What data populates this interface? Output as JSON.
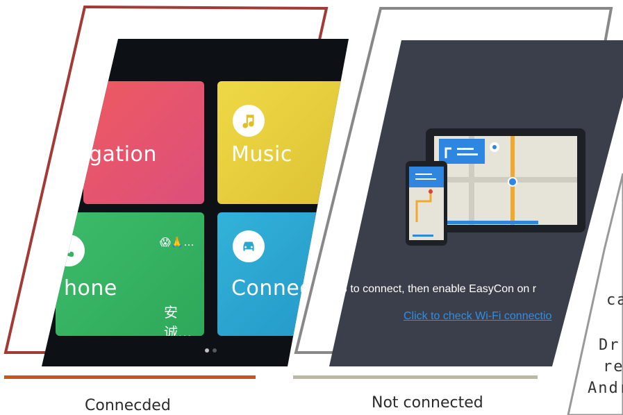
{
  "panel_connected": {
    "tiles": {
      "navigation_label": "gation",
      "music_label": "Music",
      "phone_label": "hone",
      "connect_label": "Connec",
      "phone_status_emoji": "😱🙏…",
      "phone_status_name": "安诚…"
    },
    "caption": "Connecded",
    "colors": {
      "frame_border": "#a33a36",
      "underline": "#c8561c",
      "navigation": "#e2566b",
      "music": "#e5cf3c",
      "phone": "#35b261",
      "connect": "#2aa6cf"
    }
  },
  "panel_not_connected": {
    "instruction": "3 to connect, then enable EasyCon on r",
    "wifi_link": "Click to check Wi-Fi connectio",
    "caption": "Not connected",
    "colors": {
      "frame_border": "#888888",
      "underline": "#bbb8a8",
      "background": "#3a3f4b",
      "link": "#2f8fe6"
    }
  },
  "side_text": {
    "line1": "ca",
    "line2": "Dr",
    "line3": "re",
    "line4": "Andr"
  }
}
